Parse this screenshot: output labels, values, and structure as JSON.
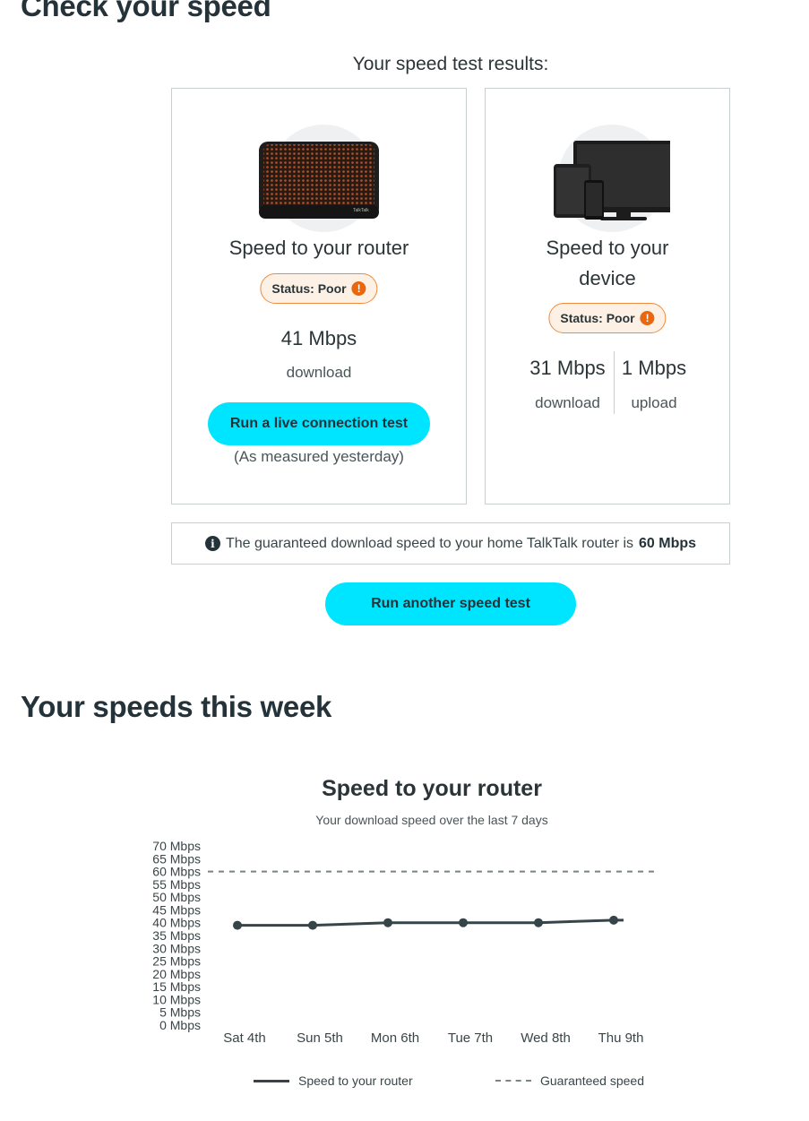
{
  "page": {
    "heading": "Check your speed",
    "results_title": "Your speed test results:",
    "week_heading": "Your speeds this week"
  },
  "router_card": {
    "title": "Speed to your router",
    "status": "Status: Poor",
    "speed": "41 Mbps",
    "speed_label": "download",
    "button": "Run a live connection test",
    "note": "(As measured yesterday)"
  },
  "device_card": {
    "title": "Speed to your device",
    "status": "Status: Poor",
    "download_speed": "31 Mbps",
    "download_label": "download",
    "upload_speed": "1 Mbps",
    "upload_label": "upload"
  },
  "info": {
    "text": "The guaranteed download speed to your home TalkTalk router is",
    "value": "60 Mbps"
  },
  "another_button": "Run another speed test",
  "colors": {
    "accent": "#00e5ff",
    "status_border": "#f08a3c",
    "status_bg": "#fdf1e6",
    "warning": "#e8670f",
    "text": "#2b3538"
  },
  "icons": {
    "status": "warning-icon",
    "info": "info-icon"
  },
  "chart_data": {
    "type": "line",
    "title": "Speed to your router",
    "subtitle": "Your download speed over the last 7 days",
    "categories": [
      "Sat 4th",
      "Sun 5th",
      "Mon 6th",
      "Tue 7th",
      "Wed 8th",
      "Thu 9th"
    ],
    "series": [
      {
        "name": "Speed to your router",
        "values": [
          39,
          39,
          40,
          40,
          40,
          41
        ]
      }
    ],
    "reference_line": {
      "name": "Guaranteed speed",
      "value": 60,
      "style": "dashed"
    },
    "y_ticks": [
      0,
      5,
      10,
      15,
      20,
      25,
      30,
      35,
      40,
      45,
      50,
      55,
      60,
      65,
      70
    ],
    "y_tick_suffix": " Mbps",
    "ylim": [
      0,
      70
    ],
    "grid": false,
    "legend_position": "bottom"
  }
}
